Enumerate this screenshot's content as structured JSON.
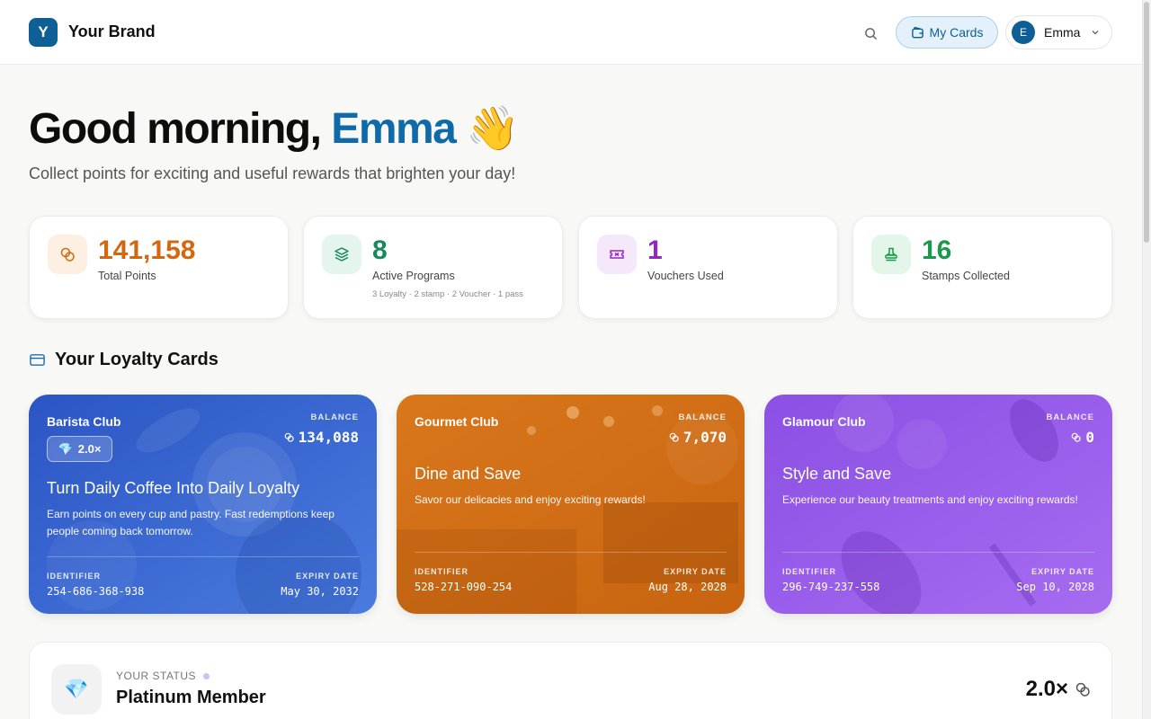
{
  "header": {
    "logo_letter": "Y",
    "brand_name": "Your Brand",
    "my_cards_label": "My Cards",
    "user": {
      "initial": "E",
      "name": "Emma"
    }
  },
  "hero": {
    "greeting_prefix": "Good morning,",
    "greeting_name": "Emma",
    "greeting_emoji": "👋",
    "subtitle": "Collect points for exciting and useful rewards that brighten your day!"
  },
  "stats": [
    {
      "value": "141,158",
      "label": "Total Points",
      "sub": "",
      "icon": "coins-icon",
      "color": "#d4680f",
      "icon_bg": "#fdf0e3"
    },
    {
      "value": "8",
      "label": "Active Programs",
      "sub": "3 Loyalty · 2 stamp · 2 Voucher · 1 pass",
      "icon": "layers-icon",
      "color": "#178a5c",
      "icon_bg": "#e4f5ed"
    },
    {
      "value": "1",
      "label": "Vouchers Used",
      "sub": "",
      "icon": "ticket-icon",
      "color": "#9426c9",
      "icon_bg": "#f5e8fb"
    },
    {
      "value": "16",
      "label": "Stamps Collected",
      "sub": "",
      "icon": "stamp-icon",
      "color": "#199a4a",
      "icon_bg": "#e4f5e9"
    }
  ],
  "section": {
    "title": "Your Loyalty Cards",
    "icon": "card-icon"
  },
  "cards": [
    {
      "club": "Barista Club",
      "balance_label": "BALANCE",
      "balance": "134,088",
      "multiplier": "2.0×",
      "headline": "Turn Daily Coffee Into Daily Loyalty",
      "description": "Earn points on every cup and pastry. Fast redemptions keep people coming back tomorrow.",
      "identifier_label": "IDENTIFIER",
      "identifier": "254-686-368-938",
      "expiry_label": "EXPIRY DATE",
      "expiry": "May 30, 2032",
      "colors": [
        "#2f5fcc",
        "#3d73d8"
      ]
    },
    {
      "club": "Gourmet Club",
      "balance_label": "BALANCE",
      "balance": "7,070",
      "headline": "Dine and Save",
      "description": "Savor our delicacies and enjoy exciting rewards!",
      "identifier_label": "IDENTIFIER",
      "identifier": "528-271-090-254",
      "expiry_label": "EXPIRY DATE",
      "expiry": "Aug 28, 2028",
      "colors": [
        "#cf6a12",
        "#e08426"
      ]
    },
    {
      "club": "Glamour Club",
      "balance_label": "BALANCE",
      "balance": "0",
      "headline": "Style and Save",
      "description": "Experience our beauty treatments and enjoy exciting rewards!",
      "identifier_label": "IDENTIFIER",
      "identifier": "296-749-237-558",
      "expiry_label": "EXPIRY DATE",
      "expiry": "Sep 10, 2028",
      "colors": [
        "#8f52e6",
        "#a46af0"
      ]
    }
  ],
  "status": {
    "label": "YOUR STATUS",
    "title": "Platinum Member",
    "multiplier": "2.0×",
    "icon": "diamond-icon"
  }
}
